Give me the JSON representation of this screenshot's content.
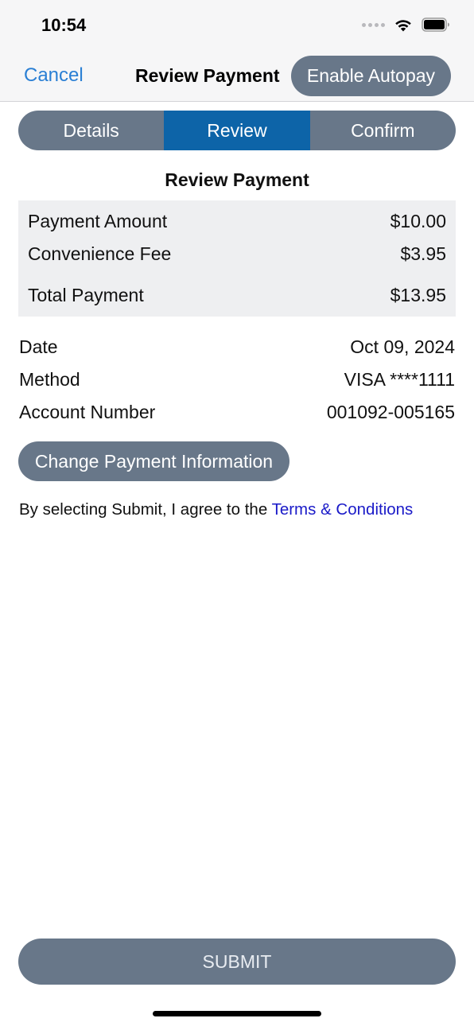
{
  "status_bar": {
    "time": "10:54",
    "icons": [
      "signal-dots-icon",
      "wifi-icon",
      "battery-icon"
    ]
  },
  "nav": {
    "cancel_label": "Cancel",
    "title": "Review Payment",
    "autopay_label": "Enable Autopay"
  },
  "steps": [
    {
      "label": "Details",
      "active": false
    },
    {
      "label": "Review",
      "active": true
    },
    {
      "label": "Confirm",
      "active": false
    }
  ],
  "section_title": "Review Payment",
  "summary": {
    "payment_amount_label": "Payment Amount",
    "payment_amount_value": "$10.00",
    "fee_label": "Convenience Fee",
    "fee_value": "$3.95",
    "total_label": "Total Payment",
    "total_value": "$13.95"
  },
  "details": {
    "date_label": "Date",
    "date_value": "Oct 09, 2024",
    "method_label": "Method",
    "method_value": "VISA ****1111",
    "account_label": "Account Number",
    "account_value": "001092-005165"
  },
  "change_payment_label": "Change Payment Information",
  "terms": {
    "prefix": "By selecting Submit, I agree to the ",
    "link_label": "Terms & Conditions"
  },
  "submit_label": "SUBMIT",
  "colors": {
    "accent_blue": "#0d64a8",
    "button_gray": "#687789",
    "link_blue": "#1a1ac8",
    "cancel_blue": "#2a7fd4"
  }
}
